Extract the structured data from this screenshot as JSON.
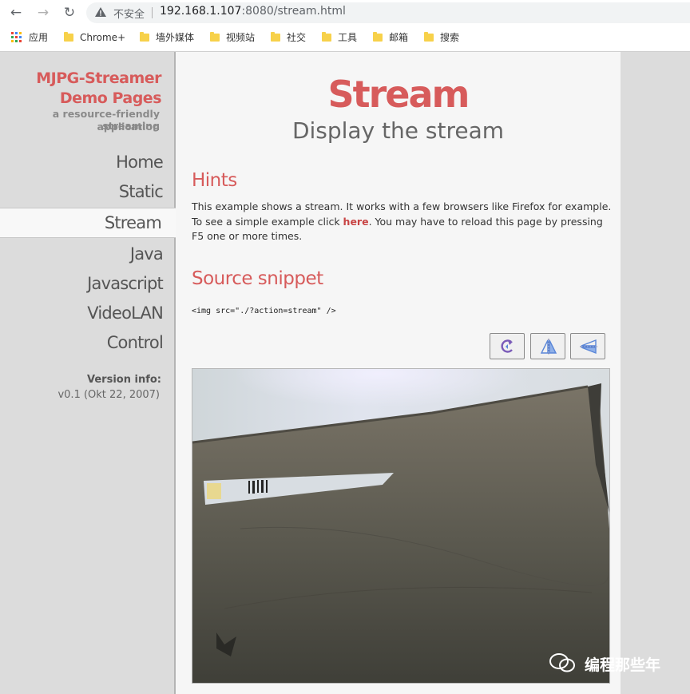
{
  "browser": {
    "security_label": "不安全",
    "url_host": "192.168.1.107",
    "url_rest": ":8080/stream.html"
  },
  "bookmarks": [
    "应用",
    "Chrome+",
    "墙外媒体",
    "视频站",
    "社交",
    "工具",
    "邮箱",
    "搜索"
  ],
  "sidebar": {
    "logo_line1": "MJPG-Streamer",
    "logo_line2": "Demo Pages",
    "tagline_line1": "a resource-friendly streaming",
    "tagline_line2": "application",
    "menu": [
      "Home",
      "Static",
      "Stream",
      "Java",
      "Javascript",
      "VideoLAN",
      "Control"
    ],
    "active_item": "Stream",
    "version_label": "Version info:",
    "version_value": "v0.1 (Okt 22, 2007)"
  },
  "main": {
    "title": "Stream",
    "subtitle": "Display the stream",
    "hints_heading": "Hints",
    "hints_text_1": "This example shows a stream. It works with a few browsers like Firefox for example. To see a simple example click ",
    "hints_link": "here",
    "hints_text_2": ". You may have to reload this page by pressing F5 one or more times.",
    "snippet_heading": "Source snippet",
    "snippet_code": "<img src=\"./?action=stream\" />",
    "toolbar_buttons": [
      "rotate-icon",
      "flip-vertical-icon",
      "flip-horizontal-icon"
    ]
  },
  "watermark": "编程那些年",
  "colors": {
    "accent": "#d75b5b",
    "sidebar_bg": "#dcdcdc",
    "content_bg": "#f6f6f6"
  }
}
